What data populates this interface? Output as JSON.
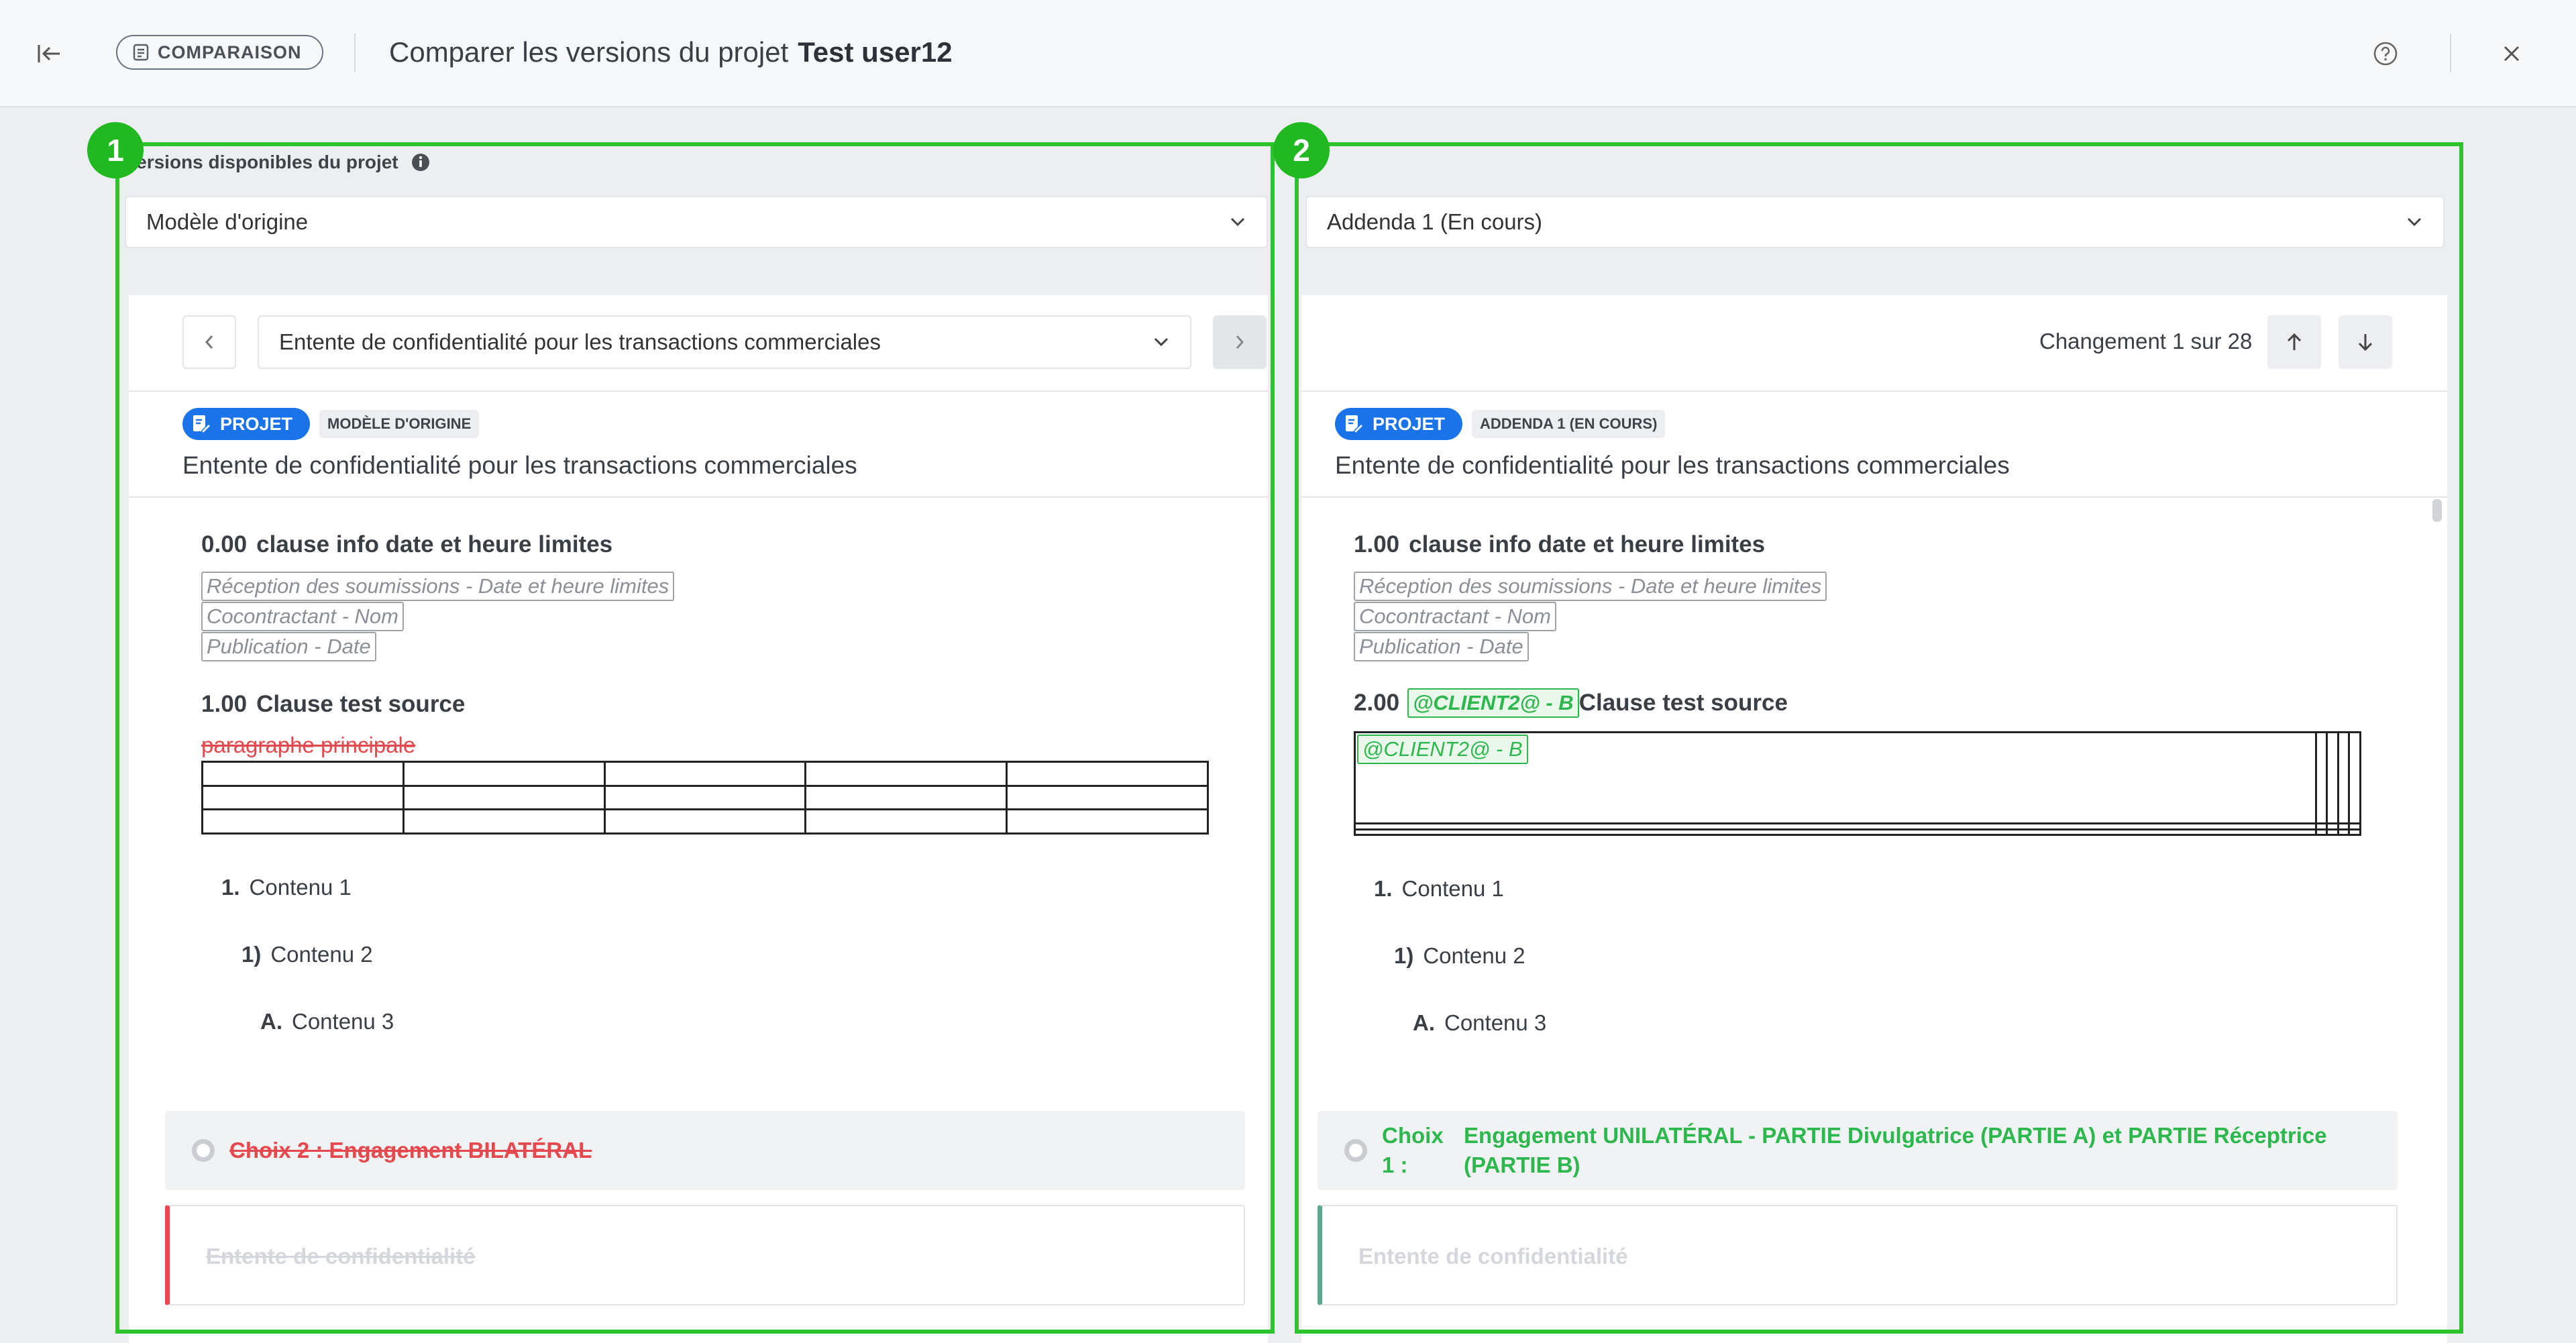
{
  "header": {
    "badge_label": "COMPARAISON",
    "title_prefix": "Comparer les versions du projet",
    "project_name": "Test user12"
  },
  "left": {
    "versions_label": "Versions disponibles du projet",
    "version_select": "Modèle d'origine",
    "document_select": "Entente de confidentialité pour les transactions commerciales",
    "projet_badge": "PROJET",
    "version_badge": "MODÈLE D'ORIGINE",
    "doc_title": "Entente de confidentialité pour les transactions commerciales",
    "clause1": {
      "number": "0.00",
      "title": "clause info date et heure limites"
    },
    "fields": [
      "Réception des soumissions - Date et heure limites",
      "Cocontractant - Nom",
      "Publication - Date"
    ],
    "clause2": {
      "number": "1.00",
      "title": "Clause test source"
    },
    "deleted_paragraph": "paragraphe principale",
    "list": [
      {
        "marker": "1.",
        "text": "Contenu 1"
      },
      {
        "marker": "1)",
        "text": "Contenu 2"
      },
      {
        "marker": "A.",
        "text": "Contenu 3"
      }
    ],
    "choice_text": "Choix 2 : Engagement BILATÉRAL",
    "subcard_text": "Entente de confidentialité"
  },
  "right": {
    "version_select": "Addenda 1 (En cours)",
    "change_counter": "Changement 1 sur 28",
    "projet_badge": "PROJET",
    "version_badge": "ADDENDA 1 (EN COURS)",
    "doc_title": "Entente de confidentialité pour les transactions commerciales",
    "clause1": {
      "number": "1.00",
      "title": "clause info date et heure limites"
    },
    "fields": [
      "Réception des soumissions - Date et heure limites",
      "Cocontractant - Nom",
      "Publication - Date"
    ],
    "clause2": {
      "number": "2.00",
      "tag": "@CLIENT2@ - B",
      "title": "Clause test source"
    },
    "table_tag": "@CLIENT2@ - B",
    "list": [
      {
        "marker": "1.",
        "text": "Contenu 1"
      },
      {
        "marker": "1)",
        "text": "Contenu 2"
      },
      {
        "marker": "A.",
        "text": "Contenu 3"
      }
    ],
    "choice_label": "Choix 1 :",
    "choice_text": "Engagement UNILATÉRAL - PARTIE Divulgatrice (PARTIE A) et PARTIE Réceptrice (PARTIE B)",
    "subcard_text": "Entente de confidentialité"
  },
  "markers": [
    "1",
    "2"
  ],
  "colors": {
    "accent_blue": "#1a73e8",
    "added_green": "#2db84d",
    "deleted_red": "#e5484d",
    "highlight_frame": "#2bc42b"
  },
  "icons": [
    "collapse-left-icon",
    "document-icon",
    "help-icon",
    "close-icon",
    "info-icon",
    "chevron-down-icon",
    "chevron-left-icon",
    "chevron-right-icon",
    "arrow-up-icon",
    "arrow-down-icon",
    "edit-document-icon"
  ]
}
